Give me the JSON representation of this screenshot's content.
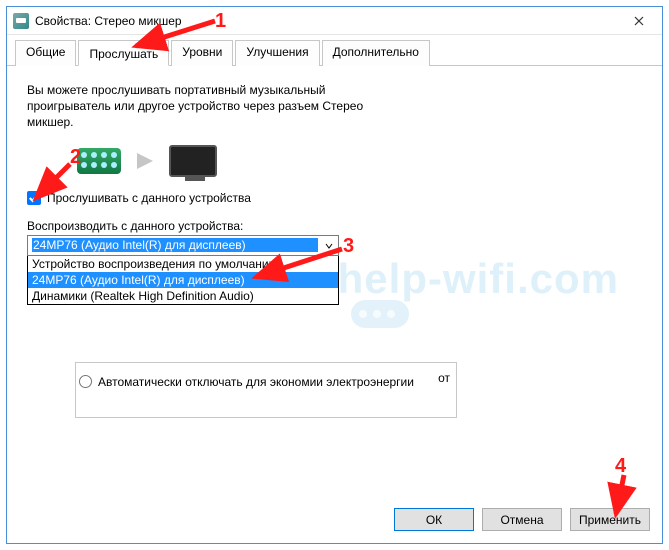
{
  "titlebar": {
    "icon": "sound-properties-icon",
    "title": "Свойства: Стерео микшер"
  },
  "tabs": [
    {
      "label": "Общие"
    },
    {
      "label": "Прослушать"
    },
    {
      "label": "Уровни"
    },
    {
      "label": "Улучшения"
    },
    {
      "label": "Дополнительно"
    }
  ],
  "intro": "Вы можете прослушивать портативный музыкальный проигрыватель или другое устройство через разъем Cтерео микшер.",
  "listen": {
    "checkbox_label": "Прослушивать с данного устройства",
    "checked": true
  },
  "playback": {
    "label": "Воспроизводить с данного устройства:",
    "selected": "24MP76 (Аудио Intel(R) для дисплеев)",
    "options": [
      "Устройство воспроизведения по умолчанию",
      "24MP76 (Аудио Intel(R) для дисплеев)",
      "Динамики (Realtek High Definition Audio)"
    ],
    "highlight_index": 1
  },
  "panel_behind_text": "от",
  "radio": {
    "label": "Автоматически отключать для экономии электроэнергии",
    "selected": false
  },
  "buttons": {
    "ok": "ОК",
    "cancel": "Отмена",
    "apply": "Применить"
  },
  "annotations": {
    "n1": "1",
    "n2": "2",
    "n3": "3",
    "n4": "4"
  },
  "watermark": "help-wifi.com"
}
